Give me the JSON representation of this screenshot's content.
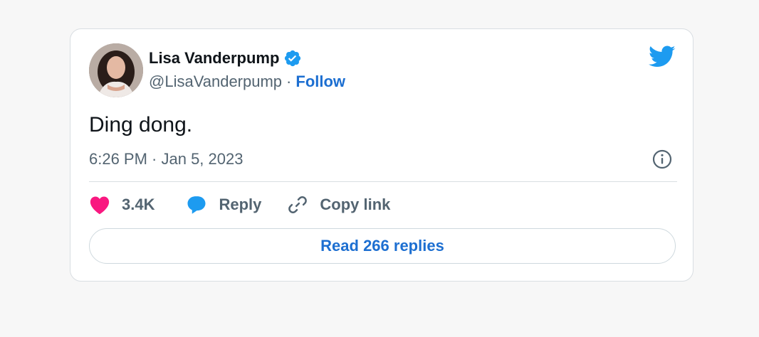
{
  "author": {
    "name": "Lisa Vanderpump",
    "handle": "@LisaVanderpump",
    "separator": "·",
    "follow_label": "Follow"
  },
  "tweet": {
    "text": "Ding dong.",
    "timestamp": "6:26 PM · Jan 5, 2023"
  },
  "actions": {
    "likes_count": "3.4K",
    "reply_label": "Reply",
    "copy_link_label": "Copy link"
  },
  "read_replies_label": "Read 266 replies",
  "icons": {
    "verified": "verified-badge-icon",
    "brand": "twitter-bird-icon",
    "info": "info-icon",
    "like": "heart-icon",
    "reply": "speech-bubble-icon",
    "copy": "link-icon"
  },
  "colors": {
    "brand_blue": "#1d9bf0",
    "link_blue": "#1d6fd1",
    "heart_pink": "#f91880",
    "text_primary": "#0f1419",
    "text_secondary": "#536471"
  }
}
